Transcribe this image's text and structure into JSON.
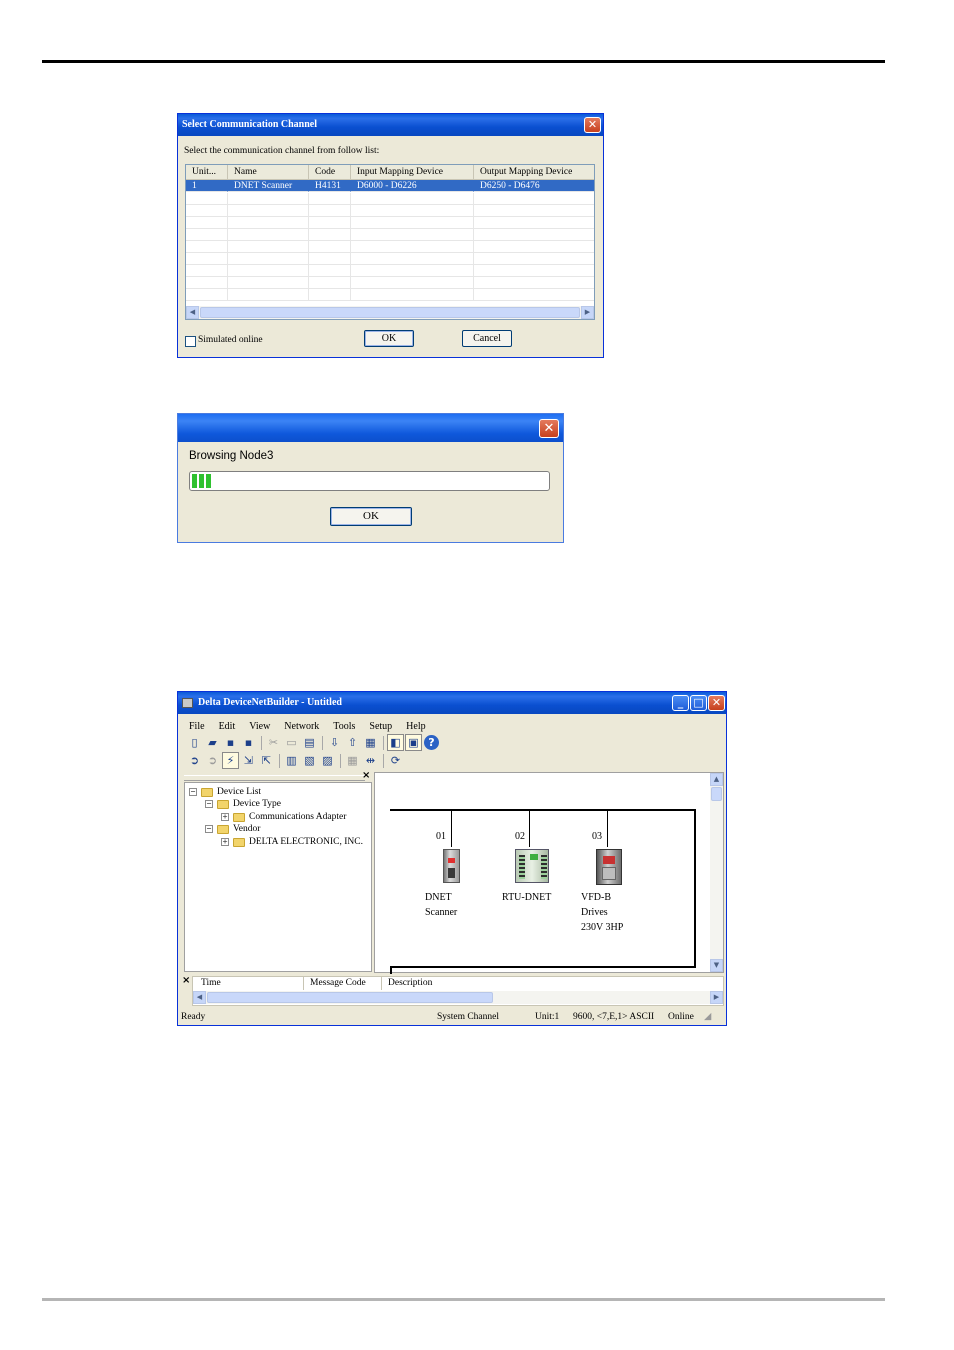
{
  "dialog1": {
    "title": "Select Communication Channel",
    "instruction": "Select the communication channel from follow list:",
    "columns": [
      "Unit...",
      "Name",
      "Code",
      "Input Mapping Device",
      "Output Mapping Device"
    ],
    "row": {
      "unit": "1",
      "name": "DNET Scanner",
      "code": "H4131",
      "input": "D6000 - D6226",
      "output": "D6250 - D6476"
    },
    "simulated_label": "Simulated online",
    "ok_label": "OK",
    "cancel_label": "Cancel",
    "close_glyph": "✕"
  },
  "dialog2": {
    "message": "Browsing Node3",
    "progress_percent": 6,
    "ok_label": "OK",
    "close_glyph": "✕"
  },
  "app": {
    "title": "Delta DeviceNetBuilder - Untitled",
    "menu": [
      "File",
      "Edit",
      "View",
      "Network",
      "Tools",
      "Setup",
      "Help"
    ],
    "tree": {
      "root": "Device List",
      "device_type": "Device Type",
      "comm_adapter": "Communications Adapter",
      "vendor": "Vendor",
      "delta": "DELTA ELECTRONIC, INC."
    },
    "nodes": [
      {
        "addr": "01",
        "line1": "DNET",
        "line2": "Scanner",
        "line3": ""
      },
      {
        "addr": "02",
        "line1": "RTU-DNET",
        "line2": "",
        "line3": ""
      },
      {
        "addr": "03",
        "line1": "VFD-B",
        "line2": "Drives",
        "line3": "230V 3HP"
      }
    ],
    "message_columns": [
      "Time",
      "Message Code",
      "Description"
    ],
    "status": {
      "ready": "Ready",
      "channel": "System Channel",
      "unit": "Unit:1",
      "comm": "9600, <7,E,1> ASCII",
      "online": "Online"
    },
    "pane_close_glyph": "×",
    "colors": {
      "title_blue": "#0a4fd0",
      "selection": "#316ac5",
      "progress_green": "#2fc12f"
    }
  }
}
